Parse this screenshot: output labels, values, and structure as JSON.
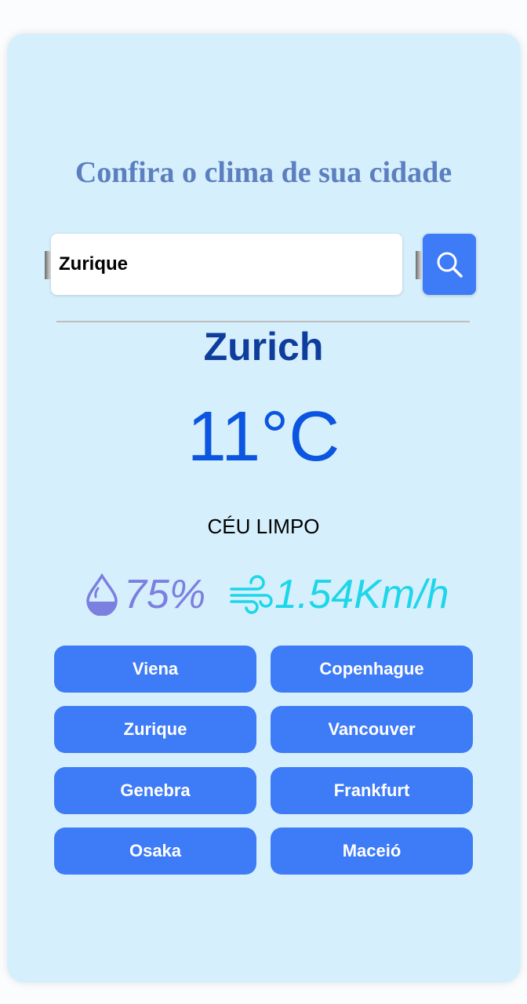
{
  "header": {
    "title": "Confira o clima de sua cidade"
  },
  "search": {
    "value": "Zurique",
    "button_icon": "search-icon"
  },
  "weather": {
    "city": "Zurich",
    "temperature": "11°C",
    "description": "CÉU LIMPO",
    "humidity": "75%",
    "humidity_icon": "droplet-icon",
    "wind": "1.54Km/h",
    "wind_icon": "wind-icon"
  },
  "cities": [
    "Viena",
    "Copenhague",
    "Zurique",
    "Vancouver",
    "Genebra",
    "Frankfurt",
    "Osaka",
    "Maceió"
  ],
  "colors": {
    "accent": "#3e7bf7",
    "card_bg": "#d6effc",
    "title": "#5b7fbf",
    "city": "#0f3d9c",
    "temperature": "#0b55e0",
    "humidity": "#7b7fe0",
    "wind": "#1dd6ea"
  }
}
